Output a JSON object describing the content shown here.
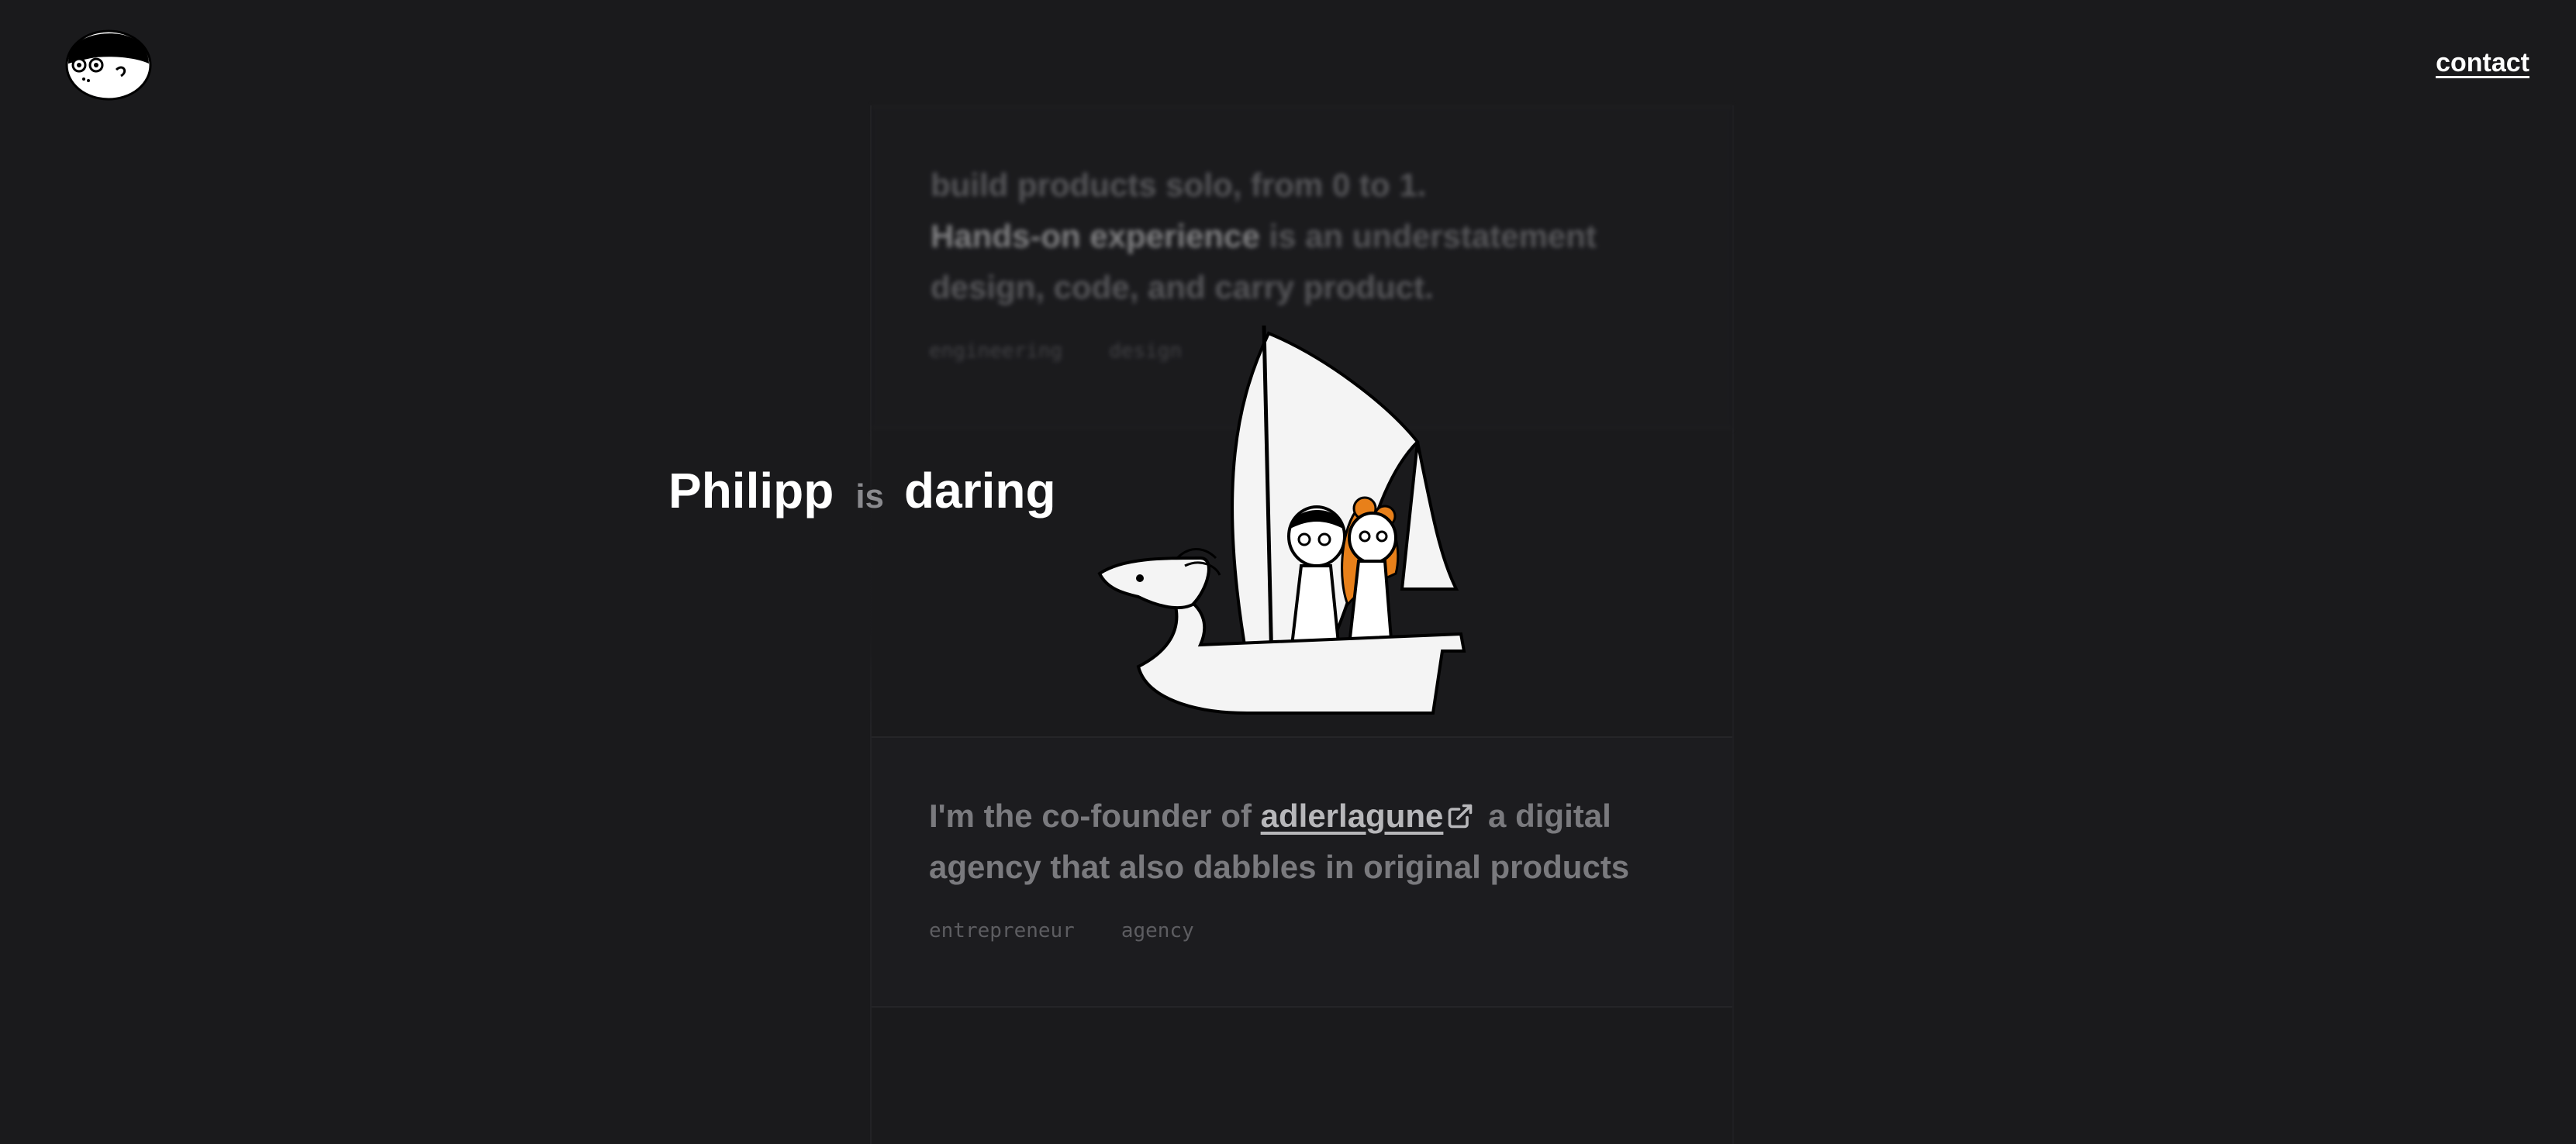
{
  "header": {
    "contact_label": "contact"
  },
  "cards": [
    {
      "line1": "build products solo, from 0 to 1.",
      "strong": "Hands-on experience",
      "line2_rest": " is an understatement",
      "line3": "design, code, and carry product.",
      "tags": [
        "engineering",
        "design"
      ]
    },
    {
      "prefix": "I'm the co-founder of ",
      "link": "adlerlagune",
      "suffix": " a digital agency that also dabbles in original products",
      "tags": [
        "entrepreneur",
        "agency"
      ]
    }
  ],
  "hero": {
    "name": "Philipp",
    "verb": "is",
    "adjective": "daring"
  },
  "colors": {
    "background": "#1a1a1c",
    "accent_hair": "#e8801a"
  }
}
